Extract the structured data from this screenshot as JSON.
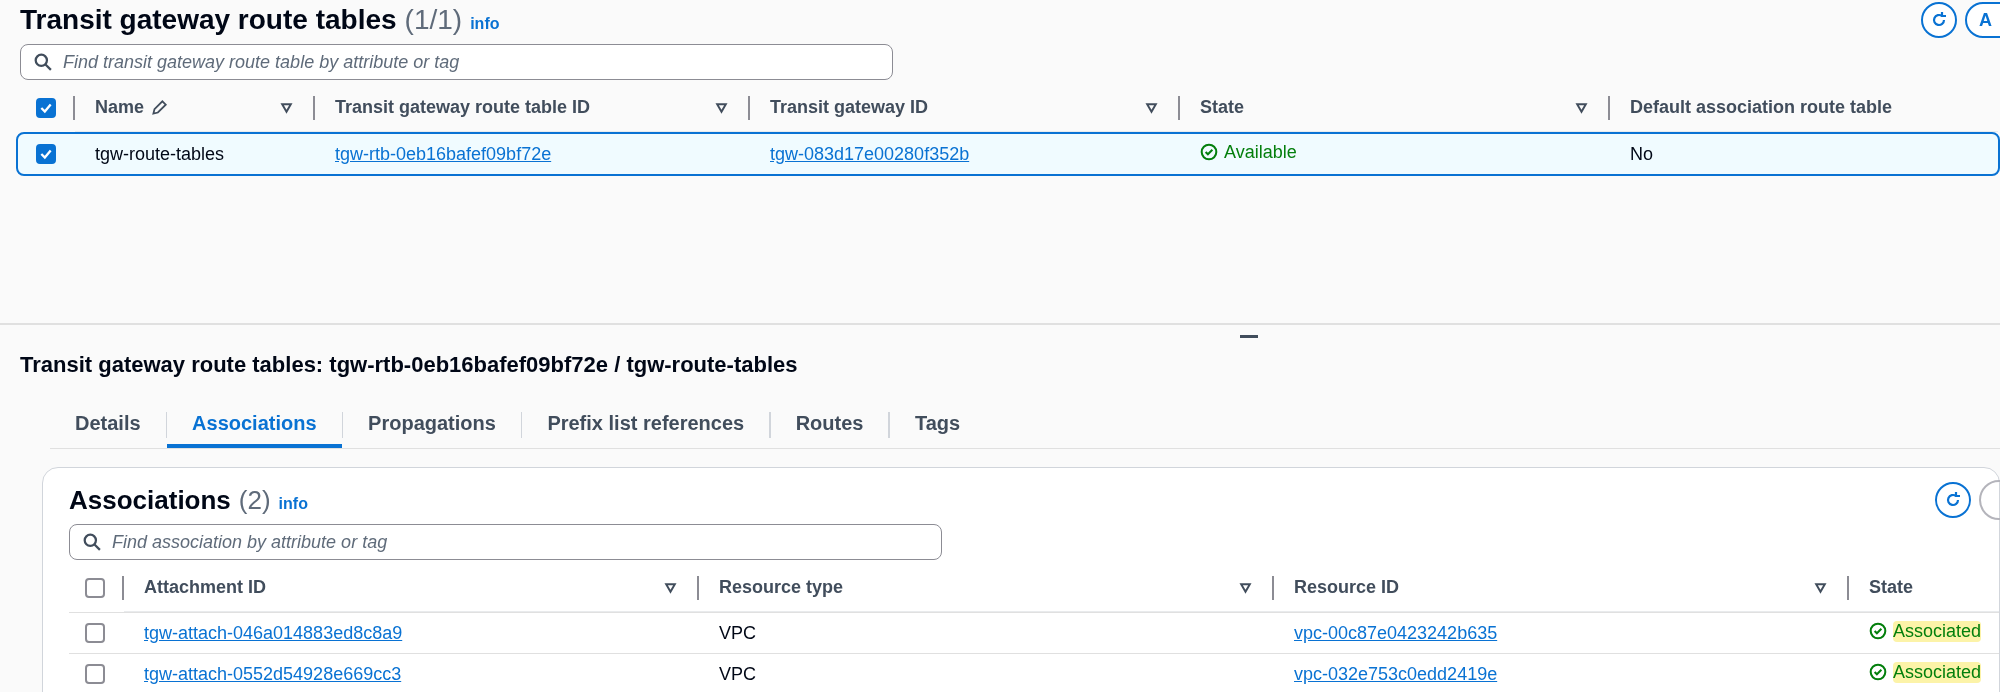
{
  "route_tables": {
    "title": "Transit gateway route tables",
    "count": "(1/1)",
    "info": "info",
    "header_buttons": [
      {
        "kind": "refresh"
      },
      {
        "kind": "text",
        "label": "A"
      }
    ],
    "search": {
      "placeholder": "Find transit gateway route table by attribute or tag"
    },
    "select_all": {
      "checked": true
    },
    "columns": [
      {
        "label": "Name",
        "editable": true,
        "filter": true
      },
      {
        "label": "Transit gateway route table ID",
        "editable": false,
        "filter": true
      },
      {
        "label": "Transit gateway ID",
        "editable": false,
        "filter": true
      },
      {
        "label": "State",
        "editable": false,
        "filter": true
      },
      {
        "label": "Default association route table",
        "editable": false,
        "filter": false
      }
    ],
    "rows": [
      {
        "selected": true,
        "cells": [
          {
            "kind": "text",
            "text": "tgw-route-tables"
          },
          {
            "kind": "link",
            "text": "tgw-rtb-0eb16bafef09bf72e"
          },
          {
            "kind": "link",
            "text": "tgw-083d17e00280f352b"
          },
          {
            "kind": "status",
            "text": "Available",
            "highlighted": false
          },
          {
            "kind": "text",
            "text": "No"
          }
        ]
      }
    ]
  },
  "detail": {
    "title": "Transit gateway route tables: tgw-rtb-0eb16bafef09bf72e / tgw-route-tables",
    "tabs": [
      {
        "label": "Details",
        "selected": false
      },
      {
        "label": "Associations",
        "selected": true
      },
      {
        "label": "Propagations",
        "selected": false
      },
      {
        "label": "Prefix list references",
        "selected": false
      },
      {
        "label": "Routes",
        "selected": false
      },
      {
        "label": "Tags",
        "selected": false
      }
    ],
    "associations": {
      "title": "Associations",
      "count": "(2)",
      "info": "info",
      "search": {
        "placeholder": "Find association by attribute or tag"
      },
      "select_all": {
        "checked": false
      },
      "columns": [
        {
          "label": "Attachment ID",
          "editable": false,
          "filter": true
        },
        {
          "label": "Resource type",
          "editable": false,
          "filter": true
        },
        {
          "label": "Resource ID",
          "editable": false,
          "filter": true
        },
        {
          "label": "State",
          "editable": false,
          "filter": false
        }
      ],
      "rows": [
        {
          "selected": false,
          "cells": [
            {
              "kind": "link",
              "text": "tgw-attach-046a014883ed8c8a9"
            },
            {
              "kind": "text",
              "text": "VPC"
            },
            {
              "kind": "link",
              "text": "vpc-00c87e0423242b635"
            },
            {
              "kind": "status",
              "text": "Associated",
              "highlighted": true
            }
          ]
        },
        {
          "selected": false,
          "cells": [
            {
              "kind": "link",
              "text": "tgw-attach-0552d54928e669cc3"
            },
            {
              "kind": "text",
              "text": "VPC"
            },
            {
              "kind": "link",
              "text": "vpc-032e753c0edd2419e"
            },
            {
              "kind": "status",
              "text": "Associated",
              "highlighted": true
            }
          ]
        }
      ]
    }
  }
}
